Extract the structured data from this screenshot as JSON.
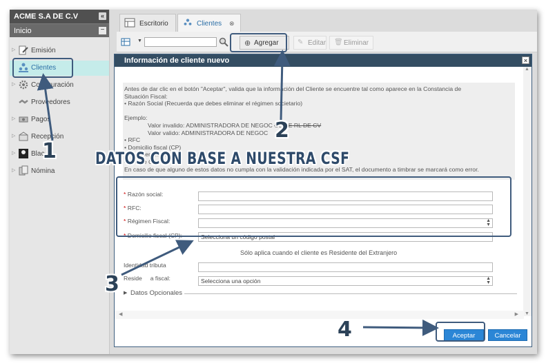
{
  "sidebar": {
    "company": "ACME S.A DE C.V",
    "collapse_glyph": "«",
    "section": "Inicio",
    "section_glyph": "−",
    "items": [
      {
        "label": "Emisión",
        "icon": "edit-document-icon"
      },
      {
        "label": "Clientes",
        "icon": "people-icon"
      },
      {
        "label": "Configuración",
        "icon": "gear-icon"
      },
      {
        "label": "Proveedores",
        "icon": "handshake-icon"
      },
      {
        "label": "Pagos",
        "icon": "money-icon"
      },
      {
        "label": "Recepción",
        "icon": "inbox-icon"
      },
      {
        "label": "Blac",
        "icon": "blacklist-icon"
      },
      {
        "label": "Nómina",
        "icon": "payroll-icon"
      }
    ]
  },
  "tabs": [
    {
      "label": "Escritorio",
      "icon": "desktop-icon"
    },
    {
      "label": "Clientes",
      "icon": "people-icon",
      "close": "⊗"
    }
  ],
  "toolbar": {
    "add": "Agregar",
    "edit": "Editar",
    "delete": "Eliminar",
    "search_value": ""
  },
  "modal": {
    "title": "Información de cliente nuevo",
    "close": "×",
    "info_lines": [
      "Antes de dar clic en el botón \"Aceptar\", valida que la información del Cliente se encuentre tal como aparece en la Constancia de",
      "Situación Fiscal:",
      "• Razón Social (Recuerda que debes eliminar el régimen societario)",
      "",
      "Ejemplo:"
    ],
    "example_invalid_prefix": "Valor invalido: ADMINISTRADORA DE NEGOC",
    "example_invalid_struck": "SC DE RL DE CV",
    "example_valid": "Valor valido: ADMINISTRADORA DE NEGOC",
    "info_lines_after": [
      "• RFC",
      "• Domicilio fiscal (CP)",
      "• Régimen fiscal",
      "• Uso de CFDI",
      "En caso de que alguno de estos datos no cumpla con la validación indicada por el SAT, el documento a timbrar se marcará como error."
    ],
    "fields": {
      "razon_social": {
        "label": "Razón social:",
        "value": ""
      },
      "rfc": {
        "label": "RFC:",
        "value": ""
      },
      "regimen": {
        "label": "Régimen Fiscal:",
        "value": ""
      },
      "domicilio": {
        "label": "Domicilio fiscal (CP):",
        "placeholder": "Selecciona un código postal"
      },
      "foreign_note": "Sólo aplica cuando el cliente es Residente del Extranjero",
      "identidad": {
        "label": "Identidad tributa",
        "value": ""
      },
      "residencia": {
        "label": "Reside",
        "label_tail": "a fiscal:",
        "placeholder": "Selecciona una opción"
      },
      "opcionales": "Datos Opcionales"
    },
    "accept": "Aceptar",
    "cancel": "Cancelar"
  },
  "annotations": {
    "banner": "DATOS CON BASE A NUESTRA CSF",
    "n1": "1",
    "n2": "2",
    "n3": "3",
    "n4": "4",
    "color": "#3f5b7d"
  }
}
